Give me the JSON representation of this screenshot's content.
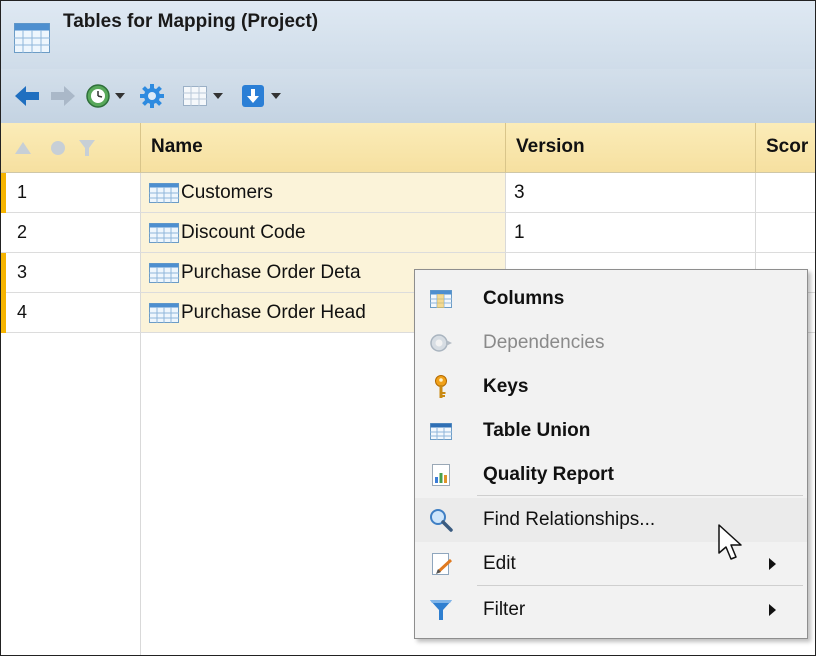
{
  "window": {
    "title": "Tables for Mapping (Project)"
  },
  "toolbar": {
    "icons": [
      "back-arrow-icon",
      "forward-arrow-icon",
      "clock-icon",
      "chevron-down-icon",
      "gear-icon",
      "grid-icon",
      "chevron-down-icon",
      "download-icon",
      "chevron-down-icon"
    ]
  },
  "table": {
    "columns": [
      "Name",
      "Version",
      "Scor"
    ],
    "rows": [
      {
        "num": "1",
        "name": "Customers",
        "version": "3",
        "marked": true
      },
      {
        "num": "2",
        "name": "Discount Code",
        "version": "1",
        "marked": false
      },
      {
        "num": "3",
        "name": "Purchase Order Deta",
        "version": "",
        "marked": true
      },
      {
        "num": "4",
        "name": "Purchase Order Head",
        "version": "",
        "marked": true
      }
    ]
  },
  "context_menu": {
    "items": [
      {
        "label": "Columns",
        "icon": "columns-icon",
        "bold": true,
        "disabled": false,
        "submenu": false
      },
      {
        "label": "Dependencies",
        "icon": "dependencies-icon",
        "bold": false,
        "disabled": true,
        "submenu": false
      },
      {
        "label": "Keys",
        "icon": "key-icon",
        "bold": true,
        "disabled": false,
        "submenu": false
      },
      {
        "label": "Table Union",
        "icon": "table-union-icon",
        "bold": true,
        "disabled": false,
        "submenu": false
      },
      {
        "label": "Quality Report",
        "icon": "quality-report-icon",
        "bold": true,
        "disabled": false,
        "submenu": false
      },
      {
        "label": "Find Relationships...",
        "icon": "search-icon",
        "bold": false,
        "disabled": false,
        "submenu": false
      },
      {
        "label": "Edit",
        "icon": "edit-icon",
        "bold": false,
        "disabled": false,
        "submenu": true
      },
      {
        "label": "Filter",
        "icon": "filter-icon",
        "bold": false,
        "disabled": false,
        "submenu": true
      }
    ]
  },
  "colors": {
    "header_bg": "#f6e0a0",
    "selected_marker": "#f6b400",
    "title_bg": "#cfdce9",
    "name_cell_bg": "#fbf3d9"
  }
}
